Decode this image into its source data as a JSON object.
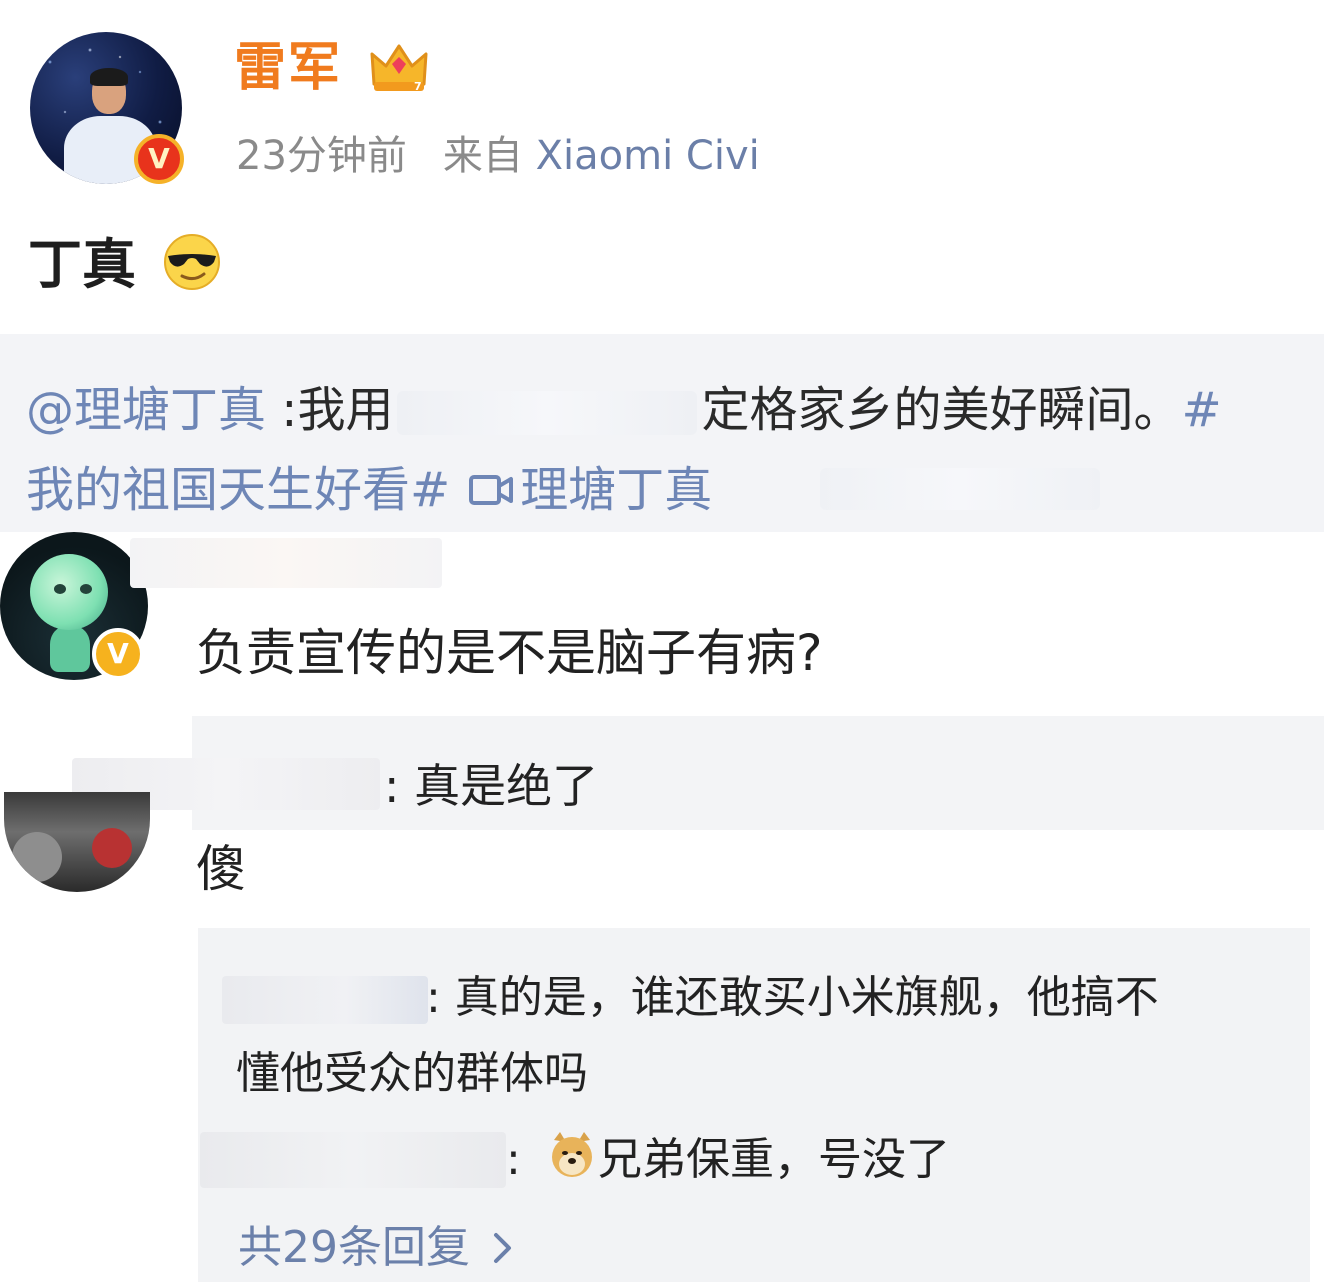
{
  "post": {
    "author": "雷军",
    "time": "23分钟前",
    "source_prefix": "来自",
    "source_device": "Xiaomi Civi",
    "text": "丁真",
    "verified_mark": "V"
  },
  "repost": {
    "mention": "@理塘丁真",
    "prefix": " :我用",
    "suffix": "定格家乡的美好瞬间。",
    "hash_start": "#",
    "line2_hashtag": "我的祖国天生好看#",
    "video_link_label": "理塘丁真"
  },
  "comments": [
    {
      "text": "负责宣传的是不是脑子有病?",
      "verified_mark": "V",
      "replies": [
        {
          "text": ": 真是绝了"
        }
      ]
    },
    {
      "text": "傻",
      "replies": [
        {
          "line1": ": 真的是，谁还敢买小米旗舰，他搞不",
          "line2": "懂他受众的群体吗"
        },
        {
          "colon": ":",
          "text": "兄弟保重，号没了"
        }
      ],
      "more_replies": "共29条回复"
    }
  ],
  "colors": {
    "author_name": "#f07b1e",
    "link_blue": "#6e86b6",
    "meta_gray": "#8a8a8a",
    "repost_bg": "#f3f4f7",
    "reply_bg": "#f2f3f5",
    "verified_red": "#e8331c",
    "verified_gold": "#f6b21e"
  },
  "icons": [
    "crown-level-icon",
    "cool-sunglasses-emoji-icon",
    "video-link-icon",
    "doge-emoji-icon",
    "chevron-right-icon",
    "verified-badge-icon"
  ]
}
